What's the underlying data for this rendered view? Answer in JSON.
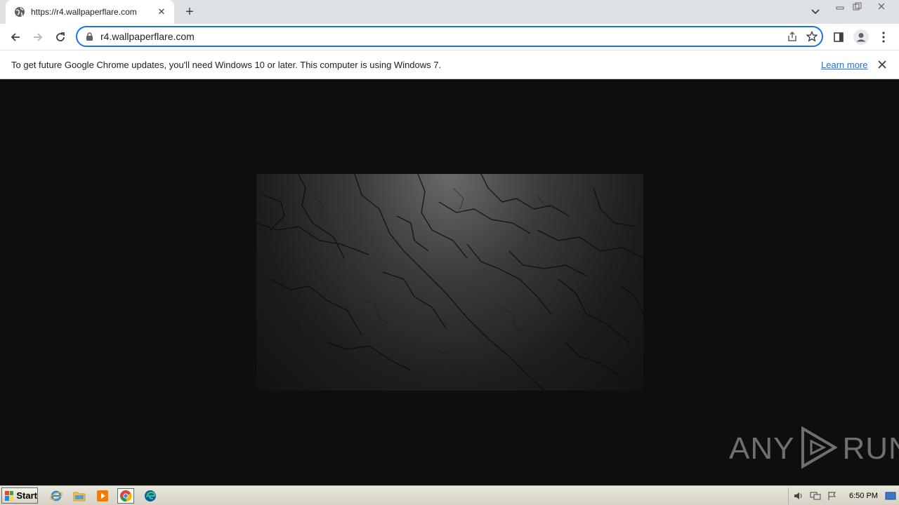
{
  "browser": {
    "tab": {
      "title": "https://r4.wallpaperflare.com",
      "favicon": "globe-icon"
    },
    "omnibox": {
      "url": "r4.wallpaperflare.com"
    },
    "accent_color": "#1a73e8"
  },
  "infobar": {
    "message": "To get future Google Chrome updates, you'll need Windows 10 or later. This computer is using Windows 7.",
    "link": "Learn more"
  },
  "watermark": {
    "text_left": "ANY",
    "text_right": "RUN"
  },
  "taskbar": {
    "start_label": "Start",
    "apps": [
      "internet-explorer-icon",
      "file-explorer-icon",
      "media-player-icon",
      "chrome-icon",
      "edge-icon"
    ],
    "tray_icons": [
      "volume-icon",
      "network-icon",
      "action-center-flag-icon",
      "show-desktop-icon"
    ],
    "clock": "6:50 PM"
  }
}
